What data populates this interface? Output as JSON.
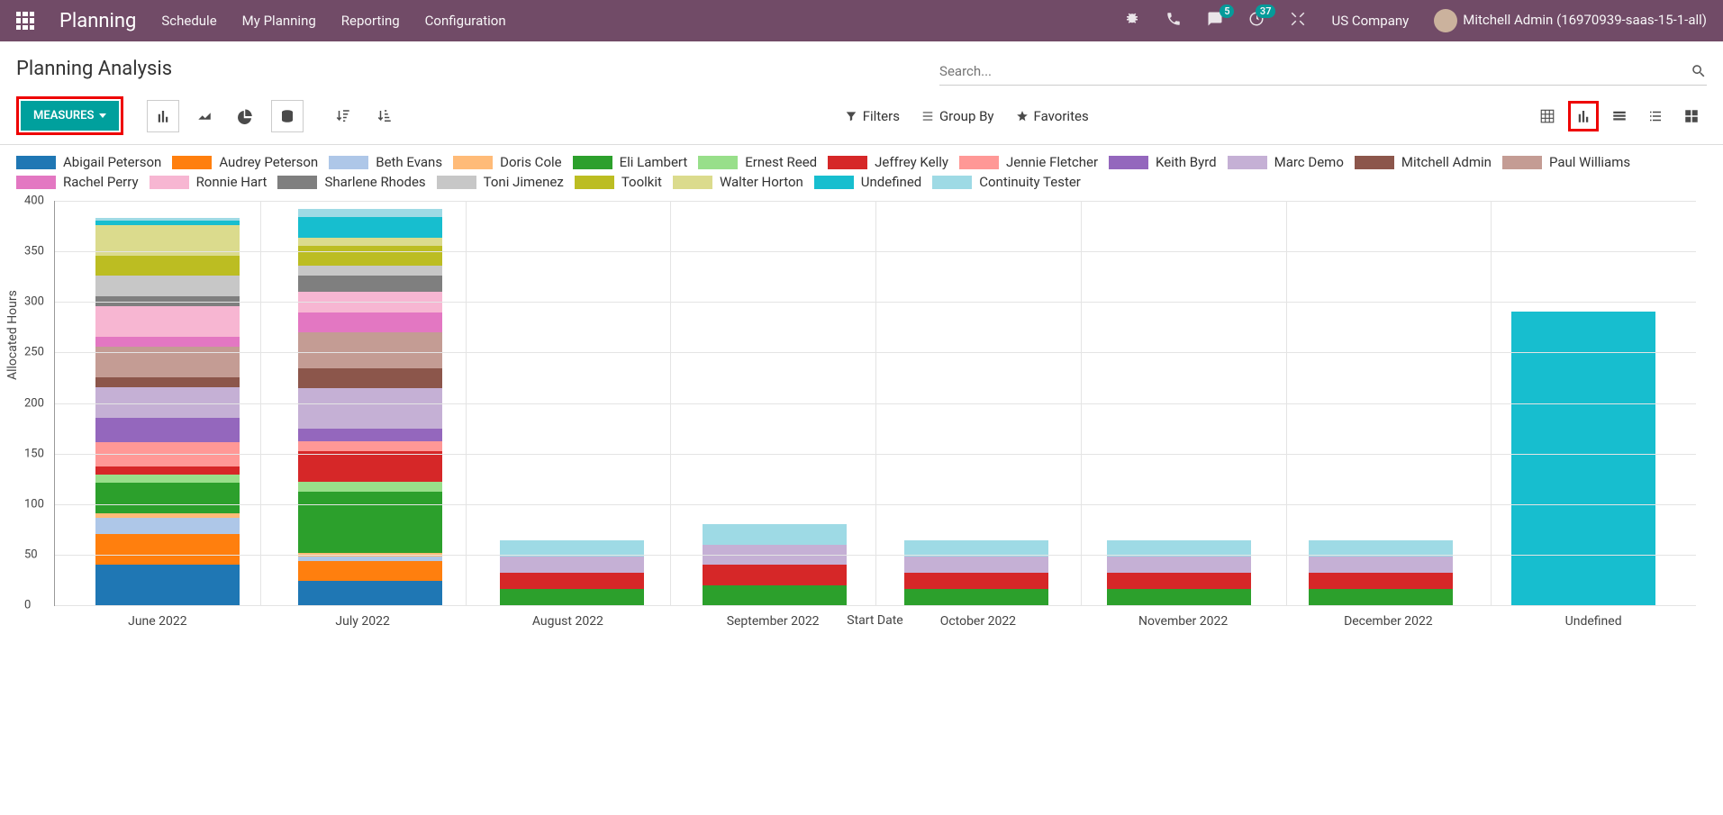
{
  "nav": {
    "brand": "Planning",
    "links": [
      "Schedule",
      "My Planning",
      "Reporting",
      "Configuration"
    ],
    "company": "US Company",
    "user": "Mitchell Admin (16970939-saas-15-1-all)",
    "badges": {
      "messages": "5",
      "activities": "37"
    }
  },
  "header": {
    "title": "Planning Analysis",
    "search_placeholder": "Search..."
  },
  "toolbar": {
    "measures_label": "MEASURES",
    "filters_label": "Filters",
    "groupby_label": "Group By",
    "favorites_label": "Favorites"
  },
  "legend": [
    {
      "label": "Abigail Peterson",
      "color": "#1f77b4"
    },
    {
      "label": "Audrey Peterson",
      "color": "#ff7f0e"
    },
    {
      "label": "Beth Evans",
      "color": "#aec7e8"
    },
    {
      "label": "Doris Cole",
      "color": "#ffbb78"
    },
    {
      "label": "Eli Lambert",
      "color": "#2ca02c"
    },
    {
      "label": "Ernest Reed",
      "color": "#98df8a"
    },
    {
      "label": "Jeffrey Kelly",
      "color": "#d62728"
    },
    {
      "label": "Jennie Fletcher",
      "color": "#ff9896"
    },
    {
      "label": "Keith Byrd",
      "color": "#9467bd"
    },
    {
      "label": "Marc Demo",
      "color": "#c5b0d5"
    },
    {
      "label": "Mitchell Admin",
      "color": "#8c564b"
    },
    {
      "label": "Paul Williams",
      "color": "#c49c94"
    },
    {
      "label": "Rachel Perry",
      "color": "#e377c2"
    },
    {
      "label": "Ronnie Hart",
      "color": "#f7b6d2"
    },
    {
      "label": "Sharlene Rhodes",
      "color": "#7f7f7f"
    },
    {
      "label": "Toni Jimenez",
      "color": "#c7c7c7"
    },
    {
      "label": "Toolkit",
      "color": "#bcbd22"
    },
    {
      "label": "Walter Horton",
      "color": "#dbdb8d"
    },
    {
      "label": "Undefined",
      "color": "#17becf"
    },
    {
      "label": "Continuity Tester",
      "color": "#9edae5"
    }
  ],
  "chart_data": {
    "type": "bar",
    "stacked": true,
    "title": "",
    "xlabel": "Start Date",
    "ylabel": "Allocated Hours",
    "ylim": [
      0,
      400
    ],
    "yticks": [
      0,
      50,
      100,
      150,
      200,
      250,
      300,
      350,
      400
    ],
    "categories": [
      "June 2022",
      "July 2022",
      "August 2022",
      "September 2022",
      "October 2022",
      "November 2022",
      "December 2022",
      "Undefined"
    ],
    "series": [
      {
        "name": "Abigail Peterson",
        "color": "#1f77b4",
        "values": [
          40,
          24,
          0,
          0,
          0,
          0,
          0,
          0
        ]
      },
      {
        "name": "Audrey Peterson",
        "color": "#ff7f0e",
        "values": [
          30,
          20,
          0,
          0,
          0,
          0,
          0,
          0
        ]
      },
      {
        "name": "Beth Evans",
        "color": "#aec7e8",
        "values": [
          16,
          4,
          0,
          0,
          0,
          0,
          0,
          0
        ]
      },
      {
        "name": "Doris Cole",
        "color": "#ffbb78",
        "values": [
          5,
          4,
          0,
          0,
          0,
          0,
          0,
          0
        ]
      },
      {
        "name": "Eli Lambert",
        "color": "#2ca02c",
        "values": [
          30,
          60,
          16,
          20,
          16,
          16,
          16,
          0
        ]
      },
      {
        "name": "Ernest Reed",
        "color": "#98df8a",
        "values": [
          8,
          10,
          0,
          0,
          0,
          0,
          0,
          0
        ]
      },
      {
        "name": "Jeffrey Kelly",
        "color": "#d62728",
        "values": [
          8,
          30,
          16,
          20,
          16,
          16,
          16,
          0
        ]
      },
      {
        "name": "Jennie Fletcher",
        "color": "#ff9896",
        "values": [
          24,
          10,
          0,
          0,
          0,
          0,
          0,
          0
        ]
      },
      {
        "name": "Keith Byrd",
        "color": "#9467bd",
        "values": [
          24,
          12,
          0,
          0,
          0,
          0,
          0,
          0
        ]
      },
      {
        "name": "Marc Demo",
        "color": "#c5b0d5",
        "values": [
          30,
          40,
          16,
          20,
          16,
          16,
          16,
          0
        ]
      },
      {
        "name": "Mitchell Admin",
        "color": "#8c564b",
        "values": [
          10,
          20,
          0,
          0,
          0,
          0,
          0,
          0
        ]
      },
      {
        "name": "Paul Williams",
        "color": "#c49c94",
        "values": [
          30,
          35,
          0,
          0,
          0,
          0,
          0,
          0
        ]
      },
      {
        "name": "Rachel Perry",
        "color": "#e377c2",
        "values": [
          10,
          20,
          0,
          0,
          0,
          0,
          0,
          0
        ]
      },
      {
        "name": "Ronnie Hart",
        "color": "#f7b6d2",
        "values": [
          30,
          20,
          0,
          0,
          0,
          0,
          0,
          0
        ]
      },
      {
        "name": "Sharlene Rhodes",
        "color": "#7f7f7f",
        "values": [
          10,
          16,
          0,
          0,
          0,
          0,
          0,
          0
        ]
      },
      {
        "name": "Toni Jimenez",
        "color": "#c7c7c7",
        "values": [
          20,
          10,
          0,
          0,
          0,
          0,
          0,
          0
        ]
      },
      {
        "name": "Toolkit",
        "color": "#bcbd22",
        "values": [
          20,
          20,
          0,
          0,
          0,
          0,
          0,
          0
        ]
      },
      {
        "name": "Walter Horton",
        "color": "#dbdb8d",
        "values": [
          30,
          8,
          0,
          0,
          0,
          0,
          0,
          0
        ]
      },
      {
        "name": "Undefined",
        "color": "#17becf",
        "values": [
          5,
          20,
          0,
          0,
          0,
          0,
          0,
          290
        ]
      },
      {
        "name": "Continuity Tester",
        "color": "#9edae5",
        "values": [
          2,
          8,
          16,
          20,
          16,
          16,
          16,
          0
        ]
      }
    ]
  }
}
